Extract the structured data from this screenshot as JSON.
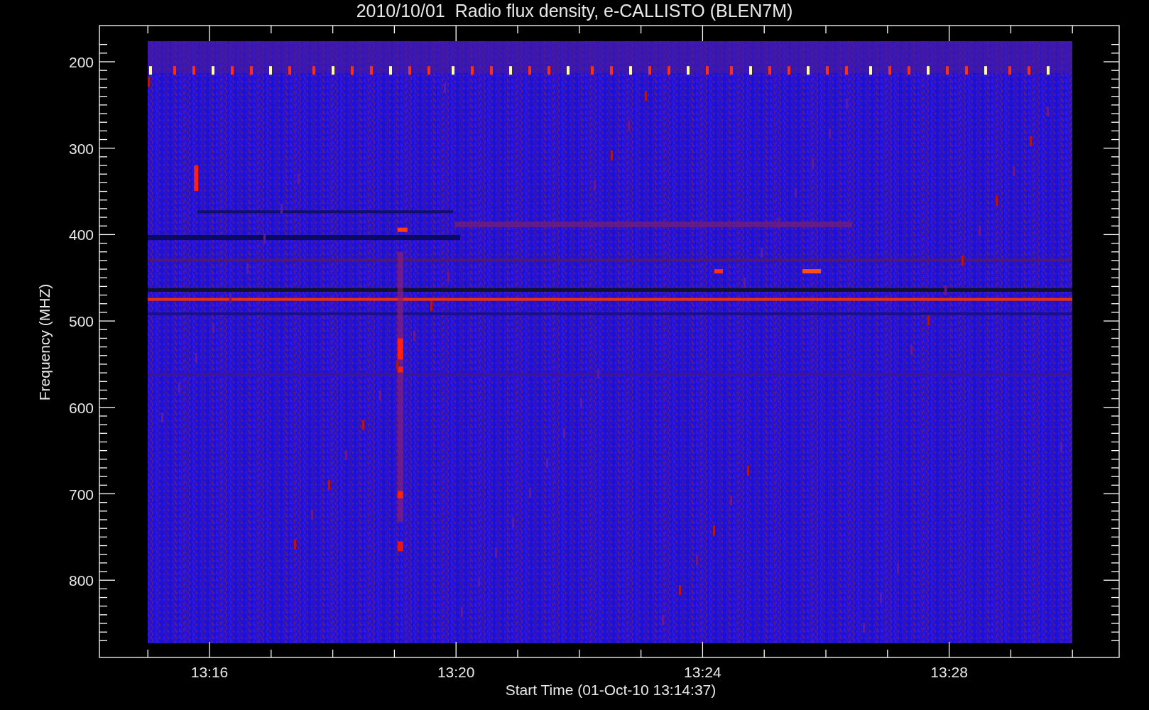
{
  "title": "2010/10/01  Radio flux density, e-CALLISTO (BLEN7M)",
  "y_axis": {
    "label": "Frequency (MHZ)",
    "ticks": [
      "200",
      "300",
      "400",
      "500",
      "600",
      "700",
      "800"
    ]
  },
  "x_axis": {
    "label": "Start Time (01-Oct-10 13:14:37)",
    "ticks": [
      "13:16",
      "13:20",
      "13:24",
      "13:28"
    ]
  }
}
